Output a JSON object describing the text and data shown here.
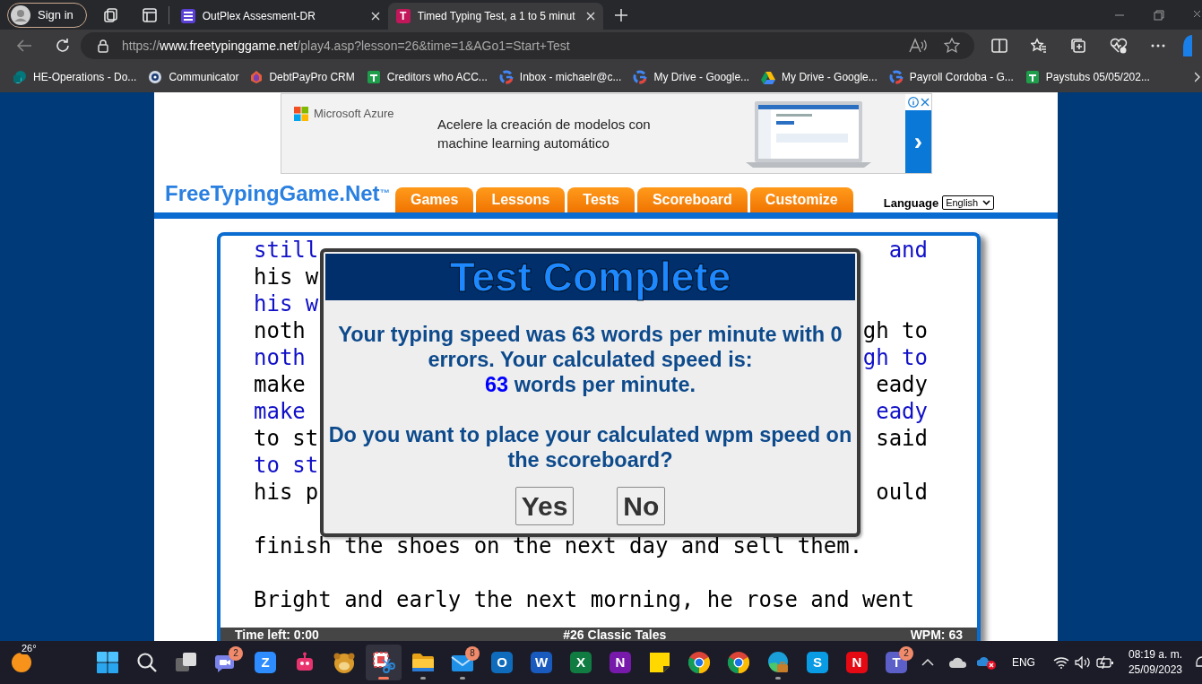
{
  "browser": {
    "profile_button": "Sign in",
    "tabs": [
      {
        "title": "OutPlex Assesment-DR",
        "selected": false
      },
      {
        "title": "Timed Typing Test, a 1 to 5 minut",
        "glyph": "T",
        "selected": true
      }
    ],
    "url": {
      "scheme": "https://",
      "domain": "www.freetypinggame.net",
      "path": "/play4.asp?lesson=26&time=1&AGo1=Start+Test"
    },
    "bookmarks": [
      {
        "title": "HE-Operations - Do..."
      },
      {
        "title": "Communicator"
      },
      {
        "title": "DebtPayPro CRM"
      },
      {
        "title": "Creditors who ACC..."
      },
      {
        "title": "Inbox - michaelr@c..."
      },
      {
        "title": "My Drive - Google..."
      },
      {
        "title": "My Drive - Google..."
      },
      {
        "title": "Payroll Cordoba - G..."
      },
      {
        "title": "Paystubs 05/05/202..."
      }
    ]
  },
  "ad": {
    "brand": "Microsoft Azure",
    "headline": "Acelere la creación de modelos con machine learning automático",
    "arrow": "›"
  },
  "site": {
    "logo": "FreeTypingGame.Net$^{™}$",
    "nav": [
      {
        "label": "Games"
      },
      {
        "label": "Lessons"
      },
      {
        "label": "Tests"
      },
      {
        "label": "Scoreboard"
      },
      {
        "label": "Customize"
      }
    ],
    "language_label": "Language",
    "language": "English"
  },
  "typing": {
    "lines": [
      {
        "kind": "typed",
        "left": "still",
        "right": "and"
      },
      {
        "kind": "source",
        "left": "his w"
      },
      {
        "kind": "typed",
        "left": "his w"
      },
      {
        "kind": "source",
        "left": "noth",
        "right": "gh to"
      },
      {
        "kind": "typed",
        "left": "noth",
        "right": "gh to"
      },
      {
        "kind": "source",
        "left": "make",
        "right": "eady"
      },
      {
        "kind": "typed",
        "left": "make",
        "right": "eady"
      },
      {
        "kind": "source",
        "left": "to st",
        "right": "said"
      },
      {
        "kind": "typed",
        "left": "to st"
      },
      {
        "kind": "source",
        "left": "his p",
        "right": "ould"
      },
      {
        "kind": "blank"
      },
      {
        "kind": "source",
        "left": "finish the shoes on the next day and sell them."
      },
      {
        "kind": "blank"
      },
      {
        "kind": "source",
        "left": "Bright and early the next morning, he rose and went"
      }
    ],
    "status": {
      "time_left": "Time left: 0:00",
      "lesson": "#26 Classic Tales",
      "wpm": "WPM: 63"
    }
  },
  "dialog": {
    "title": "Test Complete",
    "message": "Your typing speed was 63 words per minute with 0 errors. Your calculated speed is:",
    "speed": "63",
    "speed_unit": "words per minute.",
    "question": "Do you want to place your calculated wpm speed on the scoreboard?",
    "buttons": [
      "Yes",
      "No"
    ]
  },
  "taskbar": {
    "weather": "26°",
    "apps": [
      {
        "kind": "start",
        "active": false,
        "running": false
      },
      {
        "kind": "search",
        "active": false,
        "running": false
      },
      {
        "kind": "taskview",
        "active": false,
        "running": false
      },
      {
        "kind": "chat",
        "active": false,
        "running": false,
        "badge": "2"
      },
      {
        "kind": "letter",
        "glyph": "Z",
        "color": "#2d8cff",
        "active": false,
        "running": false
      },
      {
        "kind": "robot",
        "active": false,
        "running": false
      },
      {
        "kind": "bear",
        "active": false,
        "running": false
      },
      {
        "kind": "snip",
        "active": true,
        "running": true
      },
      {
        "kind": "folder",
        "active": false,
        "running": true
      },
      {
        "kind": "mail",
        "active": false,
        "running": true,
        "badge": "8"
      },
      {
        "kind": "letter",
        "glyph": "O",
        "color": "#0f6cbd",
        "active": false,
        "running": false
      },
      {
        "kind": "letter",
        "glyph": "W",
        "color": "#185abd",
        "active": false,
        "running": false
      },
      {
        "kind": "letter",
        "glyph": "X",
        "color": "#107c41",
        "active": false,
        "running": false
      },
      {
        "kind": "letter",
        "glyph": "N",
        "color": "#7719aa",
        "active": false,
        "running": false
      },
      {
        "kind": "sticky",
        "active": false,
        "running": false
      },
      {
        "kind": "chrome",
        "active": false,
        "running": false
      },
      {
        "kind": "chrome",
        "active": false,
        "running": false
      },
      {
        "kind": "edge",
        "active": false,
        "running": true
      },
      {
        "kind": "letter",
        "glyph": "S",
        "color": "#0a9be5",
        "active": false,
        "running": false
      },
      {
        "kind": "letter",
        "glyph": "N",
        "color": "#e50914",
        "active": false,
        "running": false
      },
      {
        "kind": "letter",
        "glyph": "T",
        "color": "#5b5fc7",
        "active": false,
        "running": false,
        "badge": "2"
      }
    ],
    "language": "ENG",
    "time": "08:19 a. m.",
    "date": "25/09/2023"
  }
}
